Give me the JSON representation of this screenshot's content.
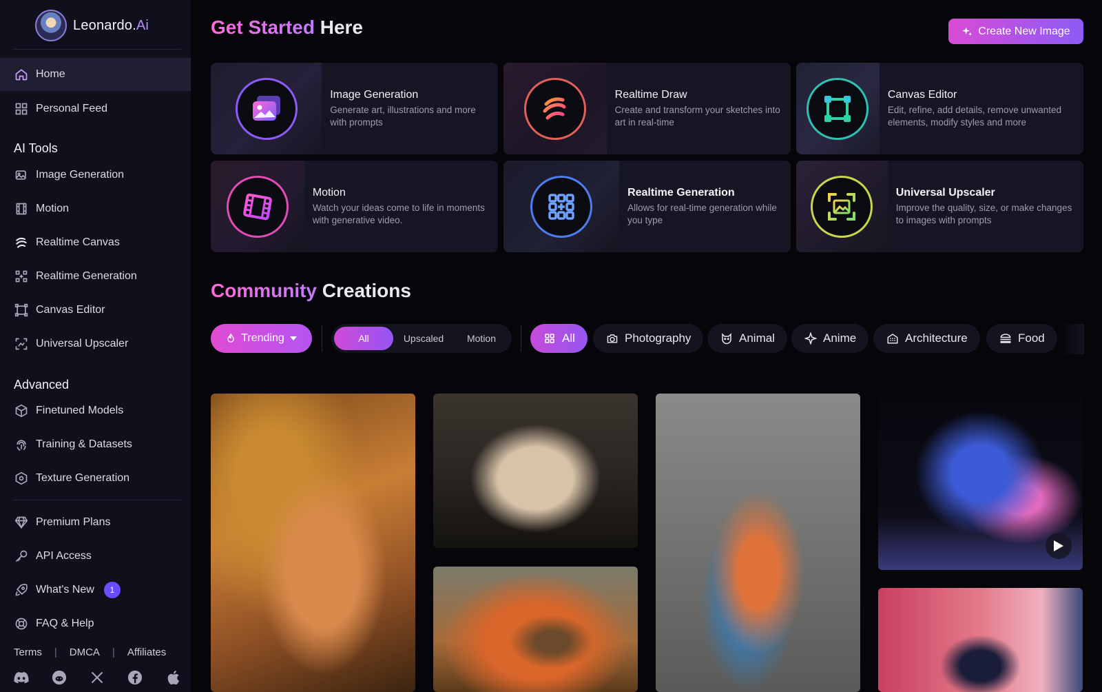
{
  "brand": {
    "name": "Leonardo.",
    "suffix": "Ai"
  },
  "sidebar": {
    "home": "Home",
    "personal_feed": "Personal Feed",
    "ai_tools_heading": "AI Tools",
    "ai_tools": [
      "Image Generation",
      "Motion",
      "Realtime Canvas",
      "Realtime Generation",
      "Canvas Editor",
      "Universal Upscaler"
    ],
    "advanced_heading": "Advanced",
    "advanced": [
      "Finetuned Models",
      "Training & Datasets",
      "Texture Generation"
    ],
    "extras": [
      "Premium Plans",
      "API Access",
      "What's New",
      "FAQ & Help"
    ],
    "whats_new_badge": "1",
    "footer_links": [
      "Terms",
      "DMCA",
      "Affiliates"
    ],
    "social_icons": [
      "discord-icon",
      "reddit-icon",
      "x-icon",
      "facebook-icon",
      "apple-icon"
    ]
  },
  "header": {
    "title_accent": "Get Started",
    "title_rest": " Here",
    "create_button": "Create New Image"
  },
  "tools": [
    {
      "title": "Image Generation",
      "desc": "Generate art, illustrations and more with prompts",
      "icon": "image-generation-icon"
    },
    {
      "title": "Realtime Draw",
      "desc": "Create and transform your sketches into art in real-time",
      "icon": "realtime-draw-icon"
    },
    {
      "title": "Canvas Editor",
      "desc": "Edit, refine, add details, remove unwanted elements, modify styles and more",
      "icon": "canvas-editor-icon"
    },
    {
      "title": "Motion",
      "desc": "Watch your ideas come to life in moments with generative video.",
      "icon": "motion-icon"
    },
    {
      "title": "Realtime Generation",
      "desc": "Allows for real-time generation while you type",
      "icon": "realtime-generation-icon"
    },
    {
      "title": "Universal Upscaler",
      "desc": "Improve the quality, size, or make changes to images with prompts",
      "icon": "universal-upscaler-icon"
    }
  ],
  "community": {
    "title_accent": "Community",
    "title_rest": " Creations",
    "sort": "Trending",
    "type_filters": [
      "All",
      "Upscaled",
      "Motion"
    ],
    "type_selected": "All",
    "categories": [
      "All",
      "Photography",
      "Animal",
      "Anime",
      "Architecture",
      "Food"
    ],
    "category_selected": "All"
  },
  "gallery": [
    {
      "subject": "golden-helmet-portrait"
    },
    {
      "subject": "striped-handbag"
    },
    {
      "subject": "geometric-dress"
    },
    {
      "subject": "iridescent-blob",
      "video": true
    },
    {
      "subject": "chameleon"
    },
    {
      "subject": "illustrated-girl"
    }
  ],
  "colors": {
    "accent_pink": "#e04bd3",
    "accent_violet": "#8b5cf6",
    "sidebar_bg": "#10101d",
    "page_bg": "#05050a"
  }
}
